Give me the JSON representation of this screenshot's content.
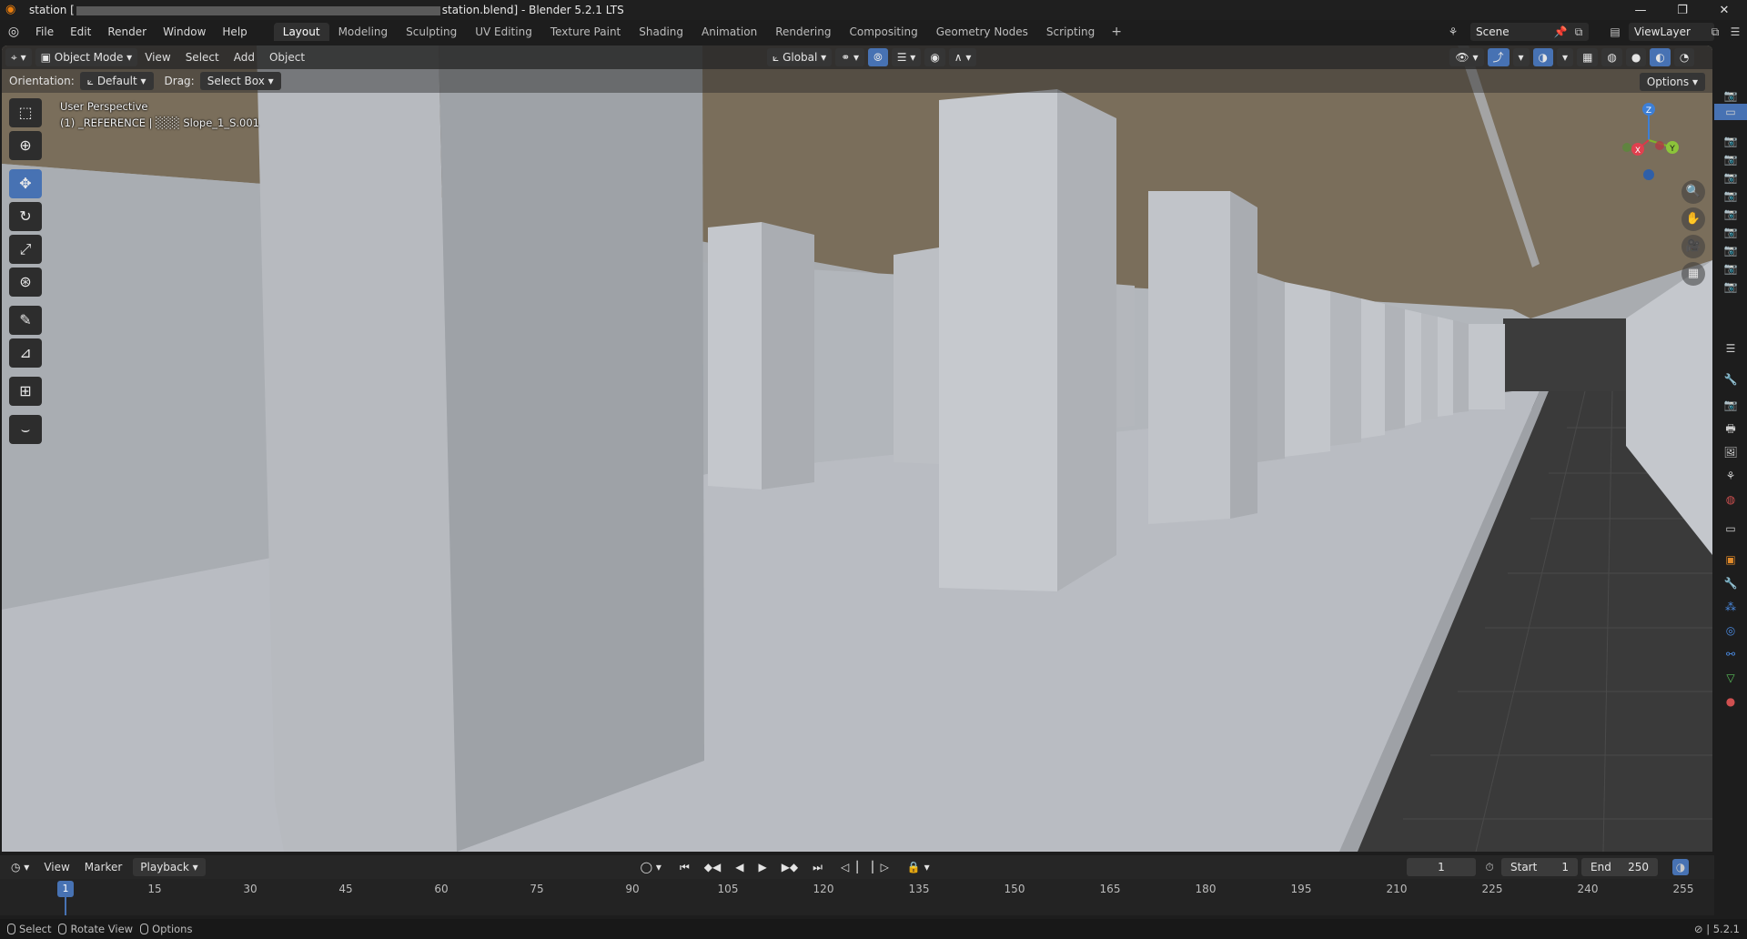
{
  "window": {
    "title_prefix": "station [",
    "title_suffix": "station.blend] - Blender 5.2.1 LTS",
    "minimize_icon": "minimize-icon",
    "maximize_icon": "maximize-icon",
    "close_icon": "close-icon"
  },
  "menu": {
    "items": [
      "File",
      "Edit",
      "Render",
      "Window",
      "Help"
    ]
  },
  "workspaces": {
    "tabs": [
      "Layout",
      "Modeling",
      "Sculpting",
      "UV Editing",
      "Texture Paint",
      "Shading",
      "Animation",
      "Rendering",
      "Compositing",
      "Geometry Nodes",
      "Scripting"
    ],
    "active": "Layout",
    "add_label": "+"
  },
  "scene": {
    "name": "Scene"
  },
  "view_layer": {
    "name": "ViewLayer"
  },
  "viewport_header": {
    "mode": "Object Mode",
    "menus": [
      "View",
      "Select",
      "Add",
      "Object"
    ],
    "transform_orientation": "Global"
  },
  "tool_settings": {
    "orientation_label": "Orientation:",
    "orientation_value": "Default",
    "drag_label": "Drag:",
    "drag_value": "Select Box",
    "options_label": "Options"
  },
  "viewport_info": {
    "perspective": "User Perspective",
    "object": "(1) _REFERENCE | ░░░ Slope_1_S.001"
  },
  "gizmo": {
    "x": "X",
    "y": "Y",
    "z": "Z"
  },
  "tools": [
    {
      "name": "select-box-icon",
      "glyph": "⬚"
    },
    {
      "name": "cursor-icon",
      "glyph": "⊕"
    },
    {
      "name": "move-icon",
      "glyph": "✥"
    },
    {
      "name": "rotate-icon",
      "glyph": "↻"
    },
    {
      "name": "scale-icon",
      "glyph": "⤢"
    },
    {
      "name": "transform-icon",
      "glyph": "⊛"
    },
    {
      "name": "annotate-icon",
      "glyph": "✎"
    },
    {
      "name": "measure-icon",
      "glyph": "📐"
    },
    {
      "name": "add-cube-icon",
      "glyph": "⊞"
    },
    {
      "name": "extrude-curve-icon",
      "glyph": "⌣"
    }
  ],
  "timeline": {
    "menus": [
      "View",
      "Marker"
    ],
    "playback_label": "Playback",
    "current_frame": "1",
    "start_label": "Start",
    "start_value": "1",
    "end_label": "End",
    "end_value": "250",
    "ticks": [
      "15",
      "30",
      "45",
      "60",
      "75",
      "90",
      "105",
      "120",
      "135",
      "150",
      "165",
      "180",
      "195",
      "210",
      "225",
      "240",
      "255"
    ],
    "playhead_frame": "1"
  },
  "statusbar": {
    "select": "Select",
    "rotate": "Rotate View",
    "options": "Options",
    "version": "5.2.1"
  },
  "colors": {
    "accent": "#4772b3",
    "ceiling": "#7a6e5b",
    "floor": "#b8bbc1",
    "track": "#3a3a3a"
  }
}
